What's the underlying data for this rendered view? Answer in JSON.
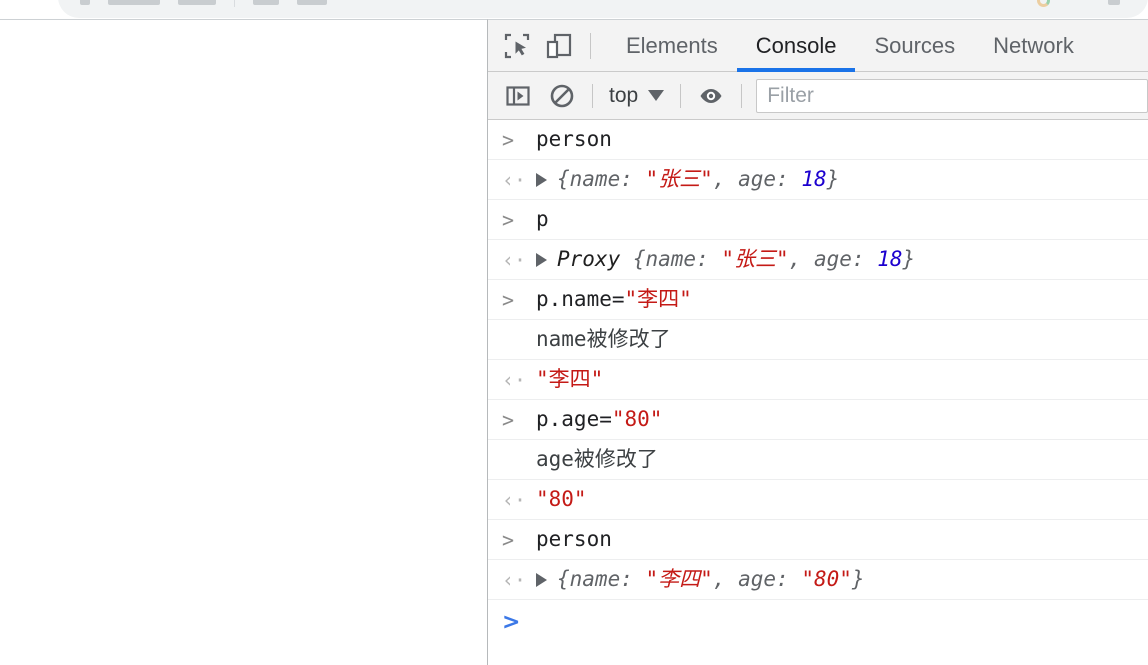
{
  "browser": {
    "omnibox_visible_sliver": true
  },
  "devtools": {
    "accent_color": "#1a73e8",
    "toolbar_icons": [
      {
        "name": "inspect-element-icon",
        "title": "Inspect element"
      },
      {
        "name": "device-toolbar-icon",
        "title": "Toggle device toolbar"
      }
    ],
    "tabs": [
      {
        "label": "Elements",
        "active": false
      },
      {
        "label": "Console",
        "active": true
      },
      {
        "label": "Sources",
        "active": false
      },
      {
        "label": "Network",
        "active": false
      }
    ],
    "console_toolbar": {
      "sidebar_toggle_icon": "show-console-sidebar-icon",
      "clear_icon": "clear-console-icon",
      "context_label": "top",
      "eye_icon": "live-expression-eye-icon",
      "filter_placeholder": "Filter",
      "filter_value": ""
    },
    "console_messages": [
      {
        "marker": ">",
        "marker_kind": "input",
        "tokens": [
          {
            "t": "person",
            "cls": "tk-plain"
          }
        ]
      },
      {
        "marker": "‹·",
        "marker_kind": "result",
        "disclosure": true,
        "tokens": [
          {
            "t": "{name: ",
            "cls": "tk-obj"
          },
          {
            "t": "\"张三\"",
            "cls": "tk-string"
          },
          {
            "t": ", age: ",
            "cls": "tk-obj"
          },
          {
            "t": "18",
            "cls": "tk-number"
          },
          {
            "t": "}",
            "cls": "tk-obj"
          }
        ]
      },
      {
        "marker": ">",
        "marker_kind": "input",
        "tokens": [
          {
            "t": "p",
            "cls": "tk-plain"
          }
        ]
      },
      {
        "marker": "‹·",
        "marker_kind": "result",
        "disclosure": true,
        "tokens": [
          {
            "t": "Proxy ",
            "cls": "tk-proxy"
          },
          {
            "t": "{name: ",
            "cls": "tk-obj"
          },
          {
            "t": "\"张三\"",
            "cls": "tk-string"
          },
          {
            "t": ", age: ",
            "cls": "tk-obj"
          },
          {
            "t": "18",
            "cls": "tk-number"
          },
          {
            "t": "}",
            "cls": "tk-obj"
          }
        ]
      },
      {
        "marker": ">",
        "marker_kind": "input",
        "tokens": [
          {
            "t": "p.name=",
            "cls": "tk-plain"
          },
          {
            "t": "\"李四\"",
            "cls": "tk-str-plain"
          }
        ]
      },
      {
        "marker": "",
        "marker_kind": "none",
        "tokens": [
          {
            "t": "name被修改了",
            "cls": "tk-cjk-log"
          }
        ]
      },
      {
        "marker": "‹·",
        "marker_kind": "result",
        "tokens": [
          {
            "t": "\"李四\"",
            "cls": "tk-str-plain"
          }
        ]
      },
      {
        "marker": ">",
        "marker_kind": "input",
        "tokens": [
          {
            "t": "p.age=",
            "cls": "tk-plain"
          },
          {
            "t": "\"80\"",
            "cls": "tk-str-plain"
          }
        ]
      },
      {
        "marker": "",
        "marker_kind": "none",
        "tokens": [
          {
            "t": "age被修改了",
            "cls": "tk-cjk-log"
          }
        ]
      },
      {
        "marker": "‹·",
        "marker_kind": "result",
        "tokens": [
          {
            "t": "\"80\"",
            "cls": "tk-str-plain"
          }
        ]
      },
      {
        "marker": ">",
        "marker_kind": "input",
        "tokens": [
          {
            "t": "person",
            "cls": "tk-plain"
          }
        ]
      },
      {
        "marker": "‹·",
        "marker_kind": "result",
        "disclosure": true,
        "tokens": [
          {
            "t": "{name: ",
            "cls": "tk-obj"
          },
          {
            "t": "\"李四\"",
            "cls": "tk-string"
          },
          {
            "t": ", age: ",
            "cls": "tk-obj"
          },
          {
            "t": "\"80\"",
            "cls": "tk-string"
          },
          {
            "t": "}",
            "cls": "tk-obj"
          }
        ]
      }
    ],
    "prompt": {
      "caret": ">",
      "value": "",
      "placeholder": ""
    }
  }
}
